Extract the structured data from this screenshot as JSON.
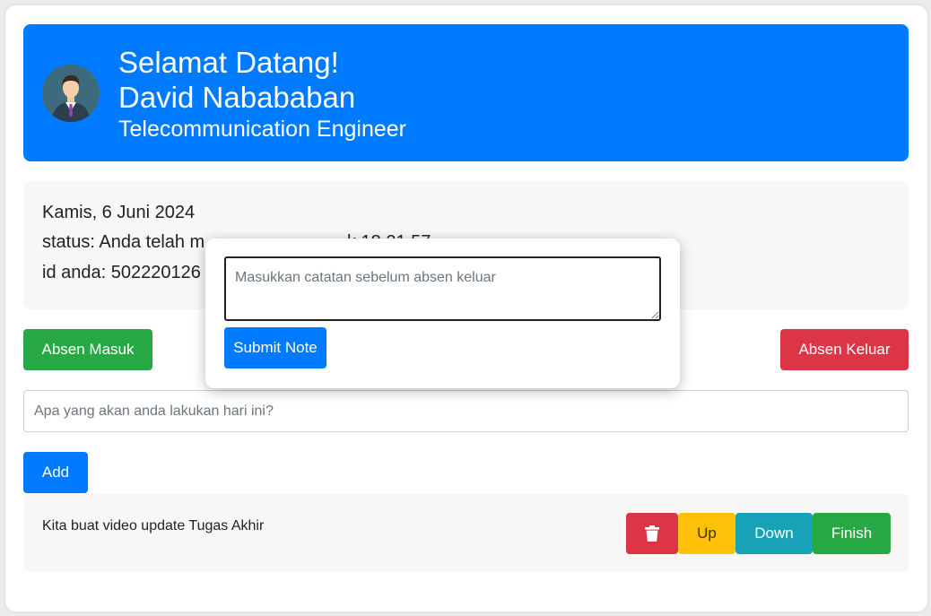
{
  "header": {
    "welcome": "Selamat Datang!",
    "name": "David Nabababan",
    "role": "Telecommunication Engineer"
  },
  "info": {
    "date": "Kamis, 6 Juni 2024",
    "status_prefix": "status: Anda telah m",
    "status_tail": "k 18.21.57",
    "id_prefix": "id anda: 502220126"
  },
  "attendance": {
    "check_in_label": "Absen Masuk",
    "check_out_label": "Absen Keluar"
  },
  "todo": {
    "placeholder": "Apa yang akan anda lakukan hari ini?",
    "add_label": "Add"
  },
  "tasks": [
    {
      "text": "Kita buat video update Tugas Akhir",
      "delete_icon": "trash-icon",
      "up_label": "Up",
      "down_label": "Down",
      "finish_label": "Finish"
    }
  ],
  "modal": {
    "note_placeholder": "Masukkan catatan sebelum absen keluar",
    "submit_label": "Submit Note"
  },
  "colors": {
    "primary": "#007bff",
    "success": "#28a745",
    "danger": "#dc3545",
    "warning": "#ffc107",
    "info": "#17a2b8"
  }
}
